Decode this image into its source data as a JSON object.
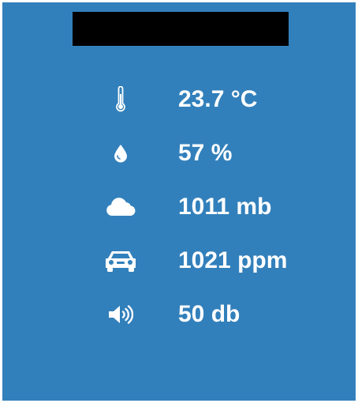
{
  "colors": {
    "background": "#3280BB",
    "title_bar": "#000000",
    "text": "#FFFFFF"
  },
  "readings": [
    {
      "icon": "thermometer-icon",
      "value": "23.7 °C"
    },
    {
      "icon": "water-drop-icon",
      "value": "57 %"
    },
    {
      "icon": "cloud-icon",
      "value": "1011 mb"
    },
    {
      "icon": "car-icon",
      "value": "1021 ppm"
    },
    {
      "icon": "speaker-volume-icon",
      "value": "50 db"
    }
  ]
}
